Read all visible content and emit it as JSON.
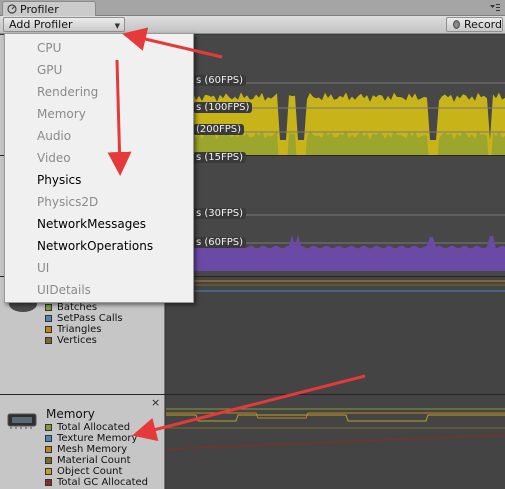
{
  "window": {
    "tab_title": "Profiler"
  },
  "toolbar": {
    "add_profiler_label": "Add Profiler",
    "record_label": "Record"
  },
  "menu": {
    "items": [
      {
        "label": "CPU",
        "enabled": false
      },
      {
        "label": "GPU",
        "enabled": false
      },
      {
        "label": "Rendering",
        "enabled": false
      },
      {
        "label": "Memory",
        "enabled": false
      },
      {
        "label": "Audio",
        "enabled": false
      },
      {
        "label": "Video",
        "enabled": false
      },
      {
        "label": "Physics",
        "enabled": true
      },
      {
        "label": "Physics2D",
        "enabled": false
      },
      {
        "label": "NetworkMessages",
        "enabled": true
      },
      {
        "label": "NetworkOperations",
        "enabled": true
      },
      {
        "label": "UI",
        "enabled": false
      },
      {
        "label": "UIDetails",
        "enabled": false
      }
    ]
  },
  "cpu_graph": {
    "fps_labels": [
      "s (60FPS)",
      "s (100FPS)",
      "(200FPS)"
    ],
    "color": "#c8b418"
  },
  "gpu_graph": {
    "fps_labels": [
      "s (15FPS)",
      "s (30FPS)",
      "s (60FPS)"
    ],
    "color": "#6b4aa6"
  },
  "rendering": {
    "legend": [
      {
        "label": "Batches",
        "color": "#7f9b3a"
      },
      {
        "label": "SetPass Calls",
        "color": "#4a86b7"
      },
      {
        "label": "Triangles",
        "color": "#c5831c"
      },
      {
        "label": "Vertices",
        "color": "#786a2a"
      }
    ]
  },
  "memory": {
    "title": "Memory",
    "close": "×",
    "legend": [
      {
        "label": "Total Allocated",
        "color": "#7f9b3a"
      },
      {
        "label": "Texture Memory",
        "color": "#4a86b7"
      },
      {
        "label": "Mesh Memory",
        "color": "#c5831c"
      },
      {
        "label": "Material Count",
        "color": "#786a2a"
      },
      {
        "label": "Object Count",
        "color": "#b8a22c"
      },
      {
        "label": "Total GC Allocated",
        "color": "#8a2d1e"
      }
    ]
  },
  "annotation": {
    "arrow_color": "#e53a3a"
  }
}
